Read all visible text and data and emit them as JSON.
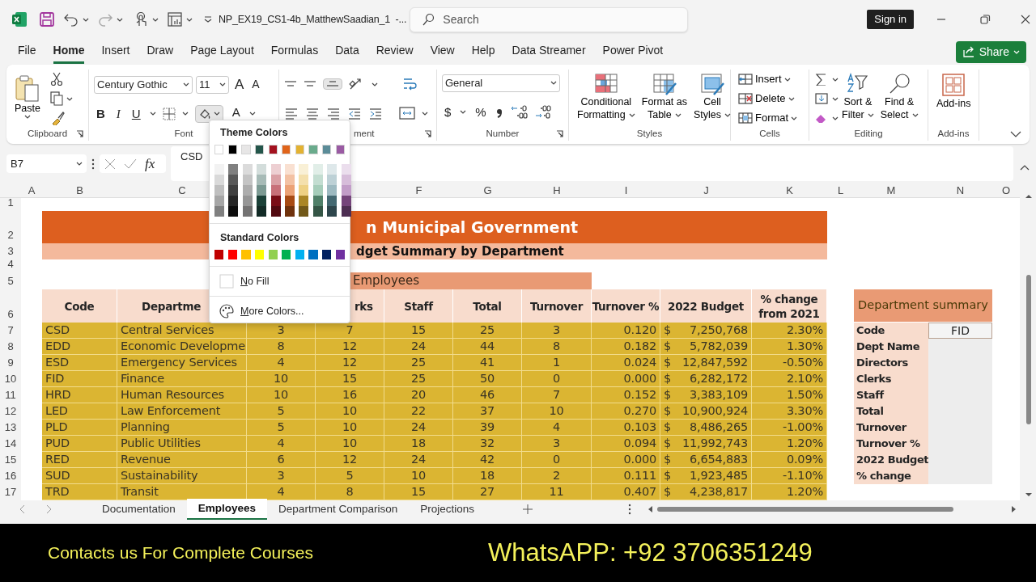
{
  "title_bar": {
    "file_name": "NP_EX19_CS1-4b_MatthewSaadian_1  -...",
    "search_placeholder": "Search",
    "sign_in": "Sign in"
  },
  "menu_tabs": [
    {
      "label": "File",
      "selected": false
    },
    {
      "label": "Home",
      "selected": true
    },
    {
      "label": "Insert",
      "selected": false
    },
    {
      "label": "Draw",
      "selected": false
    },
    {
      "label": "Page Layout",
      "selected": false
    },
    {
      "label": "Formulas",
      "selected": false
    },
    {
      "label": "Data",
      "selected": false
    },
    {
      "label": "Review",
      "selected": false
    },
    {
      "label": "View",
      "selected": false
    },
    {
      "label": "Help",
      "selected": false
    },
    {
      "label": "Data Streamer",
      "selected": false
    },
    {
      "label": "Power Pivot",
      "selected": false
    }
  ],
  "share": "Share",
  "ribbon": {
    "clipboard": {
      "label": "Clipboard",
      "paste": "Paste"
    },
    "font": {
      "label": "Font",
      "name": "Century Gothic",
      "size": "11",
      "grow": "A",
      "shrink": "A",
      "bold": "B",
      "italic": "I",
      "underline": "U",
      "font_color": "A"
    },
    "alignment": {
      "label": "ment"
    },
    "number": {
      "label": "Number",
      "format": "General",
      "currency": "$",
      "percent": "%"
    },
    "styles": {
      "label": "Styles",
      "buttons": [
        [
          "Conditional",
          "Formatting"
        ],
        [
          "Format as",
          "Table"
        ],
        [
          "Cell",
          "Styles"
        ]
      ]
    },
    "cells": {
      "label": "Cells",
      "buttons": [
        "Insert",
        "Delete",
        "Format"
      ]
    },
    "editing": {
      "label": "Editing",
      "buttons": [
        [
          "Sort &",
          "Filter"
        ],
        [
          "Find &",
          "Select"
        ]
      ]
    },
    "addins": {
      "label": "Add-ins",
      "button": "Add-ins"
    }
  },
  "fill_menu": {
    "theme_title": "Theme Colors",
    "theme_colors": [
      {
        "color": "#ffffff"
      },
      {
        "color": "#000000"
      },
      {
        "color": "#e7e6e6"
      },
      {
        "color": "#24564b"
      },
      {
        "color": "#a3111f"
      },
      {
        "color": "#e0641a"
      },
      {
        "color": "#e3b232"
      },
      {
        "color": "#6aab8c"
      },
      {
        "color": "#5b8c98"
      },
      {
        "color": "#9a5ba3"
      }
    ],
    "standard_title": "Standard Colors",
    "standard_colors": [
      {
        "color": "#c00000"
      },
      {
        "color": "#ff0000"
      },
      {
        "color": "#ffc000"
      },
      {
        "color": "#ffff00"
      },
      {
        "color": "#92d050"
      },
      {
        "color": "#00b050"
      },
      {
        "color": "#00b0f0"
      },
      {
        "color": "#0070c0"
      },
      {
        "color": "#002060"
      },
      {
        "color": "#7030a0"
      }
    ],
    "no_fill": "No Fill",
    "more_colors": "More Colors..."
  },
  "formula_bar": {
    "name_box": "B7",
    "fx": "fx",
    "content": "CSD"
  },
  "sheet": {
    "column_headers": [
      "A",
      "B",
      "C",
      "F",
      "G",
      "H",
      "I",
      "J",
      "K",
      "L",
      "M",
      "N",
      "O"
    ],
    "row_numbers": [
      "1",
      "2",
      "3",
      "4",
      "5",
      "6",
      "7",
      "8",
      "9",
      "10",
      "11",
      "12",
      "13",
      "14",
      "15",
      "16",
      "17"
    ],
    "title": "n Municipal Government",
    "subtitle": "dget Summary by Department",
    "group_header": "Employees",
    "headers": [
      [
        "Code"
      ],
      [
        "Departme"
      ],
      [
        "rks"
      ],
      [
        "Staff"
      ],
      [
        "Total"
      ],
      [
        "Turnover"
      ],
      [
        "Turnover %"
      ],
      [
        "2022 Budget"
      ],
      [
        "% change",
        "from 2021"
      ]
    ],
    "rows": [
      [
        "CSD",
        "Central Services",
        "3",
        "7",
        "15",
        "25",
        "3",
        "0.120",
        [
          "$",
          "7,250,768"
        ],
        "2.30%"
      ],
      [
        "EDD",
        "Economic Developme",
        "8",
        "12",
        "24",
        "44",
        "8",
        "0.182",
        [
          "$",
          "5,782,039"
        ],
        "1.30%"
      ],
      [
        "ESD",
        "Emergency Services",
        "4",
        "12",
        "25",
        "41",
        "1",
        "0.024",
        [
          "$",
          "12,847,592"
        ],
        "-0.50%"
      ],
      [
        "FID",
        "Finance",
        "10",
        "15",
        "25",
        "50",
        "0",
        "0.000",
        [
          "$",
          "6,282,172"
        ],
        "2.10%"
      ],
      [
        "HRD",
        "Human Resources",
        "10",
        "16",
        "20",
        "46",
        "7",
        "0.152",
        [
          "$",
          "3,383,109"
        ],
        "1.50%"
      ],
      [
        "LED",
        "Law Enforcement",
        "5",
        "10",
        "22",
        "37",
        "10",
        "0.270",
        [
          "$",
          "10,900,924"
        ],
        "3.30%"
      ],
      [
        "PLD",
        "Planning",
        "5",
        "10",
        "24",
        "39",
        "4",
        "0.103",
        [
          "$",
          "8,486,265"
        ],
        "-1.00%"
      ],
      [
        "PUD",
        "Public Utilities",
        "4",
        "10",
        "18",
        "32",
        "3",
        "0.094",
        [
          "$",
          "11,992,743"
        ],
        "1.20%"
      ],
      [
        "RED",
        "Revenue",
        "6",
        "12",
        "24",
        "42",
        "0",
        "0.000",
        [
          "$",
          "6,654,883"
        ],
        "0.09%"
      ],
      [
        "SUD",
        "Sustainability",
        "3",
        "5",
        "10",
        "18",
        "2",
        "0.111",
        [
          "$",
          "1,923,485"
        ],
        "-1.10%"
      ],
      [
        "TRD",
        "Transit",
        "4",
        "8",
        "15",
        "27",
        "11",
        "0.407",
        [
          "$",
          "4,238,817"
        ],
        "1.20%"
      ]
    ],
    "summary": {
      "title": "Department summary",
      "labels": [
        "Code",
        "Dept Name",
        "Directors",
        "Clerks",
        "Staff",
        "Total",
        "Turnover",
        "Turnover %",
        "2022 Budget",
        "% change"
      ],
      "code_value": "FID"
    }
  },
  "sheet_tabs": [
    {
      "label": "Documentation",
      "selected": false
    },
    {
      "label": "Employees",
      "selected": true
    },
    {
      "label": "Department Comparison",
      "selected": false
    },
    {
      "label": "Projections",
      "selected": false
    }
  ],
  "banner": {
    "left": "Contacts us For Complete Courses",
    "right": "WhatsAPP:  +92 3706351249"
  }
}
